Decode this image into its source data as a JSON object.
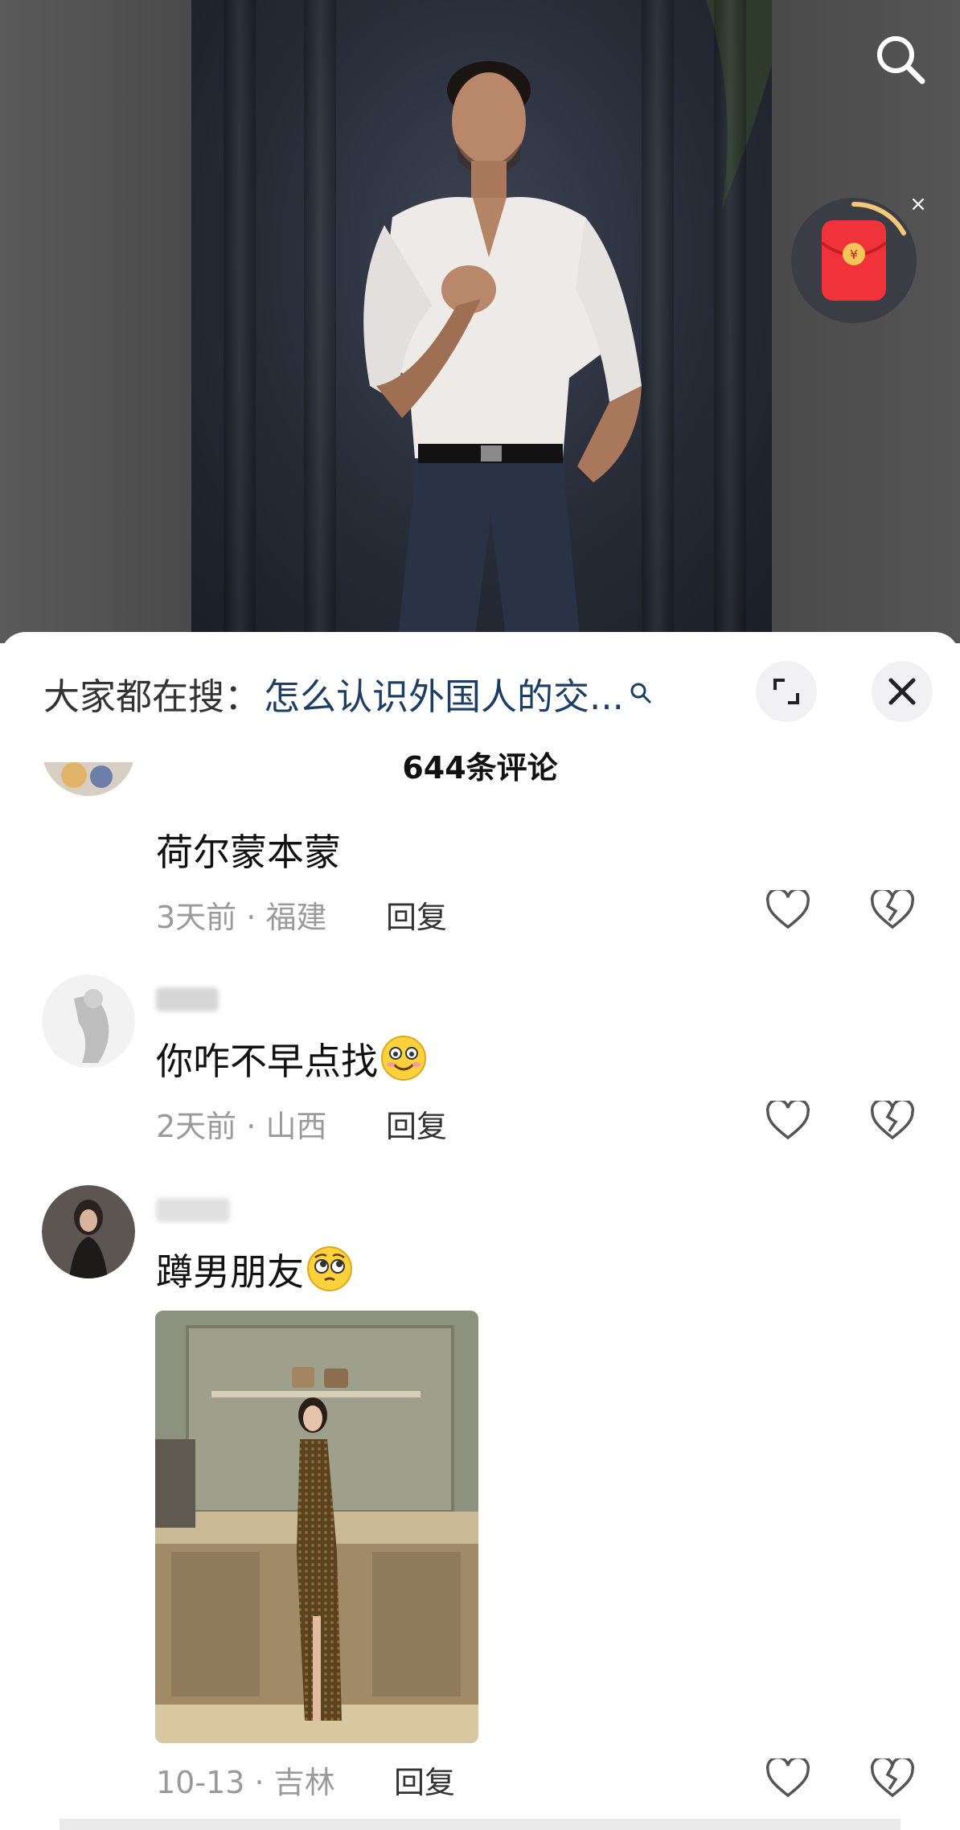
{
  "video": {
    "search_icon": "search-icon",
    "red_packet_icon": "red-packet-icon",
    "red_packet_close": "×"
  },
  "sheet": {
    "trending_prefix": "大家都在搜：",
    "trending_query": "怎么认识外国人的交...",
    "comment_count": "644条评论"
  },
  "comments": [
    {
      "text": "荷尔蒙本蒙",
      "time": "3天前",
      "location": "福建",
      "reply_label": "回复"
    },
    {
      "text": "你咋不早点找",
      "emoji": "grinning-face-emoji",
      "time": "2天前",
      "location": "山西",
      "reply_label": "回复"
    },
    {
      "text": "蹲男朋友",
      "emoji": "pleading-face-emoji",
      "time": "10-13",
      "location": "吉林",
      "reply_label": "回复"
    }
  ],
  "colors": {
    "query_blue": "#1d3e64",
    "meta_gray": "#9a9a9a",
    "red_packet": "#f0333a"
  }
}
